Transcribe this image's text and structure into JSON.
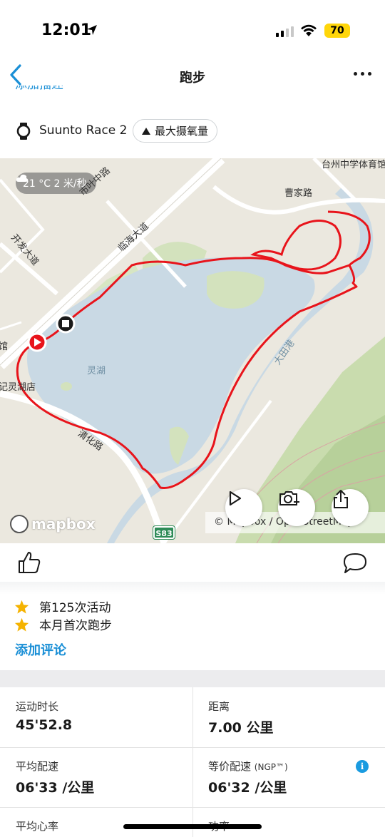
{
  "status_bar": {
    "time": "12:01",
    "battery": "70"
  },
  "nav": {
    "title": "跑步",
    "partial_text": "添加描述"
  },
  "device": {
    "name": "Suunto Race 2",
    "badge": "最大摄氧量"
  },
  "map": {
    "weather": "21 °C  2 米/秒",
    "labels": {
      "school": "台州中学体育馆",
      "cao_jia_road": "曹家路",
      "shi_ye_road": "市叶中路",
      "kai_fa_road": "开发大道",
      "lin_hai_road": "临海大道",
      "ling_lake": "灵湖",
      "qing_hua_road": "清化路",
      "da_tian_port": "大田港",
      "shop": "记灵湖店",
      "pinyin": "馆",
      "highway": "S83"
    },
    "logo": "mapbox",
    "attribution": "© Mapbox / OpenStreetMap"
  },
  "achievements": [
    {
      "icon": "star-icon",
      "text": "第125次活动"
    },
    {
      "icon": "star-icon",
      "text": "本月首次跑步"
    }
  ],
  "add_comment": "添加评论",
  "stats": {
    "duration_label": "运动时长",
    "duration_value": "45'52.8",
    "distance_label": "距离",
    "distance_value": "7.00 公里",
    "avg_pace_label": "平均配速",
    "avg_pace_value": "06'33 /公里",
    "ngp_label": "等价配速",
    "ngp_suffix": "(NGP™)",
    "ngp_value": "06'32 /公里",
    "hr_label": "平均心率",
    "power_label": "功率"
  },
  "colors": {
    "accent": "#1a8fd6",
    "route": "#e8141b",
    "star": "#f5b301",
    "water": "#c9d9e4"
  }
}
